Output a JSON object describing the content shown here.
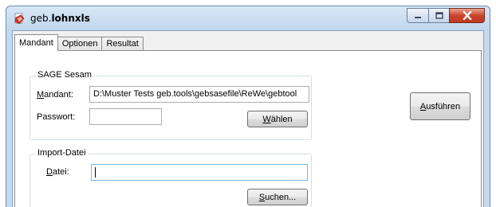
{
  "window": {
    "title_prefix": "geb.",
    "title_strong": "lohnxls",
    "accent_color": "#c23a1f"
  },
  "tabs": [
    {
      "label": "Mandant",
      "active": true
    },
    {
      "label": "Optionen",
      "active": false
    },
    {
      "label": "Resultat",
      "active": false
    }
  ],
  "sage_group": {
    "legend": "SAGE Sesam",
    "mandant_label_mnemonic": "M",
    "mandant_label_rest": "andant:",
    "mandant_value": "D:\\Muster Tests geb.tools\\gebsasefile\\ReWe\\gebtool",
    "passwort_label": "Passwort:",
    "passwort_value": "",
    "waehlen_mnemonic": "W",
    "waehlen_rest": "ählen"
  },
  "import_group": {
    "legend": "Import-Datei",
    "datei_label_mnemonic": "D",
    "datei_label_rest": "atei:",
    "datei_value": "",
    "suchen_mnemonic": "S",
    "suchen_rest": "uchen..."
  },
  "ausfuehren_mnemonic": "A",
  "ausfuehren_rest": "usführen"
}
